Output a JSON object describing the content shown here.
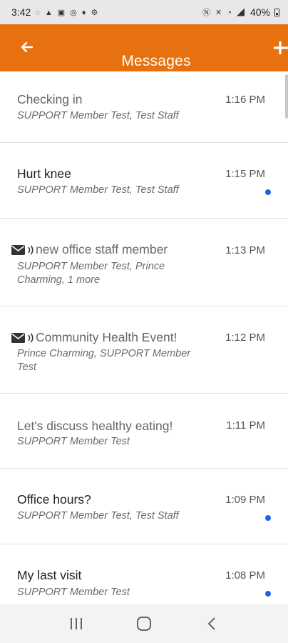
{
  "status_bar": {
    "time": "3:42",
    "battery": "40%"
  },
  "app_bar": {
    "title": "Messages",
    "accent_color": "#e8710f"
  },
  "messages": [
    {
      "subject": "Checking in",
      "participants": "SUPPORT Member Test, Test Staff",
      "time": "1:16 PM",
      "unread": false,
      "read_style": true,
      "has_icons": false
    },
    {
      "subject": "Hurt knee",
      "participants": "SUPPORT Member Test, Test Staff",
      "time": "1:15 PM",
      "unread": true,
      "read_style": false,
      "has_icons": false
    },
    {
      "subject": "new office staff member",
      "participants": "SUPPORT Member Test, Prince Charming,  1  more",
      "time": "1:13 PM",
      "unread": false,
      "read_style": true,
      "has_icons": true
    },
    {
      "subject": "Community Health Event!",
      "participants": "Prince Charming, SUPPORT Member Test",
      "time": "1:12 PM",
      "unread": false,
      "read_style": true,
      "has_icons": true
    },
    {
      "subject": "Let's discuss healthy eating!",
      "participants": "SUPPORT Member Test",
      "time": "1:11 PM",
      "unread": false,
      "read_style": true,
      "has_icons": false
    },
    {
      "subject": "Office hours?",
      "participants": "SUPPORT Member Test, Test Staff",
      "time": "1:09 PM",
      "unread": true,
      "read_style": false,
      "has_icons": false
    },
    {
      "subject": "My last visit",
      "participants": "SUPPORT Member Test",
      "time": "1:08 PM",
      "unread": true,
      "read_style": false,
      "has_icons": false
    }
  ],
  "icons": {
    "back": "arrow-left-icon",
    "add": "plus-icon",
    "message_type": [
      "envelope-icon",
      "sound-wave-icon"
    ],
    "nav": [
      "recent-apps-icon",
      "home-icon",
      "back-chevron-icon"
    ]
  },
  "colors": {
    "unread_dot": "#1f63e6"
  }
}
